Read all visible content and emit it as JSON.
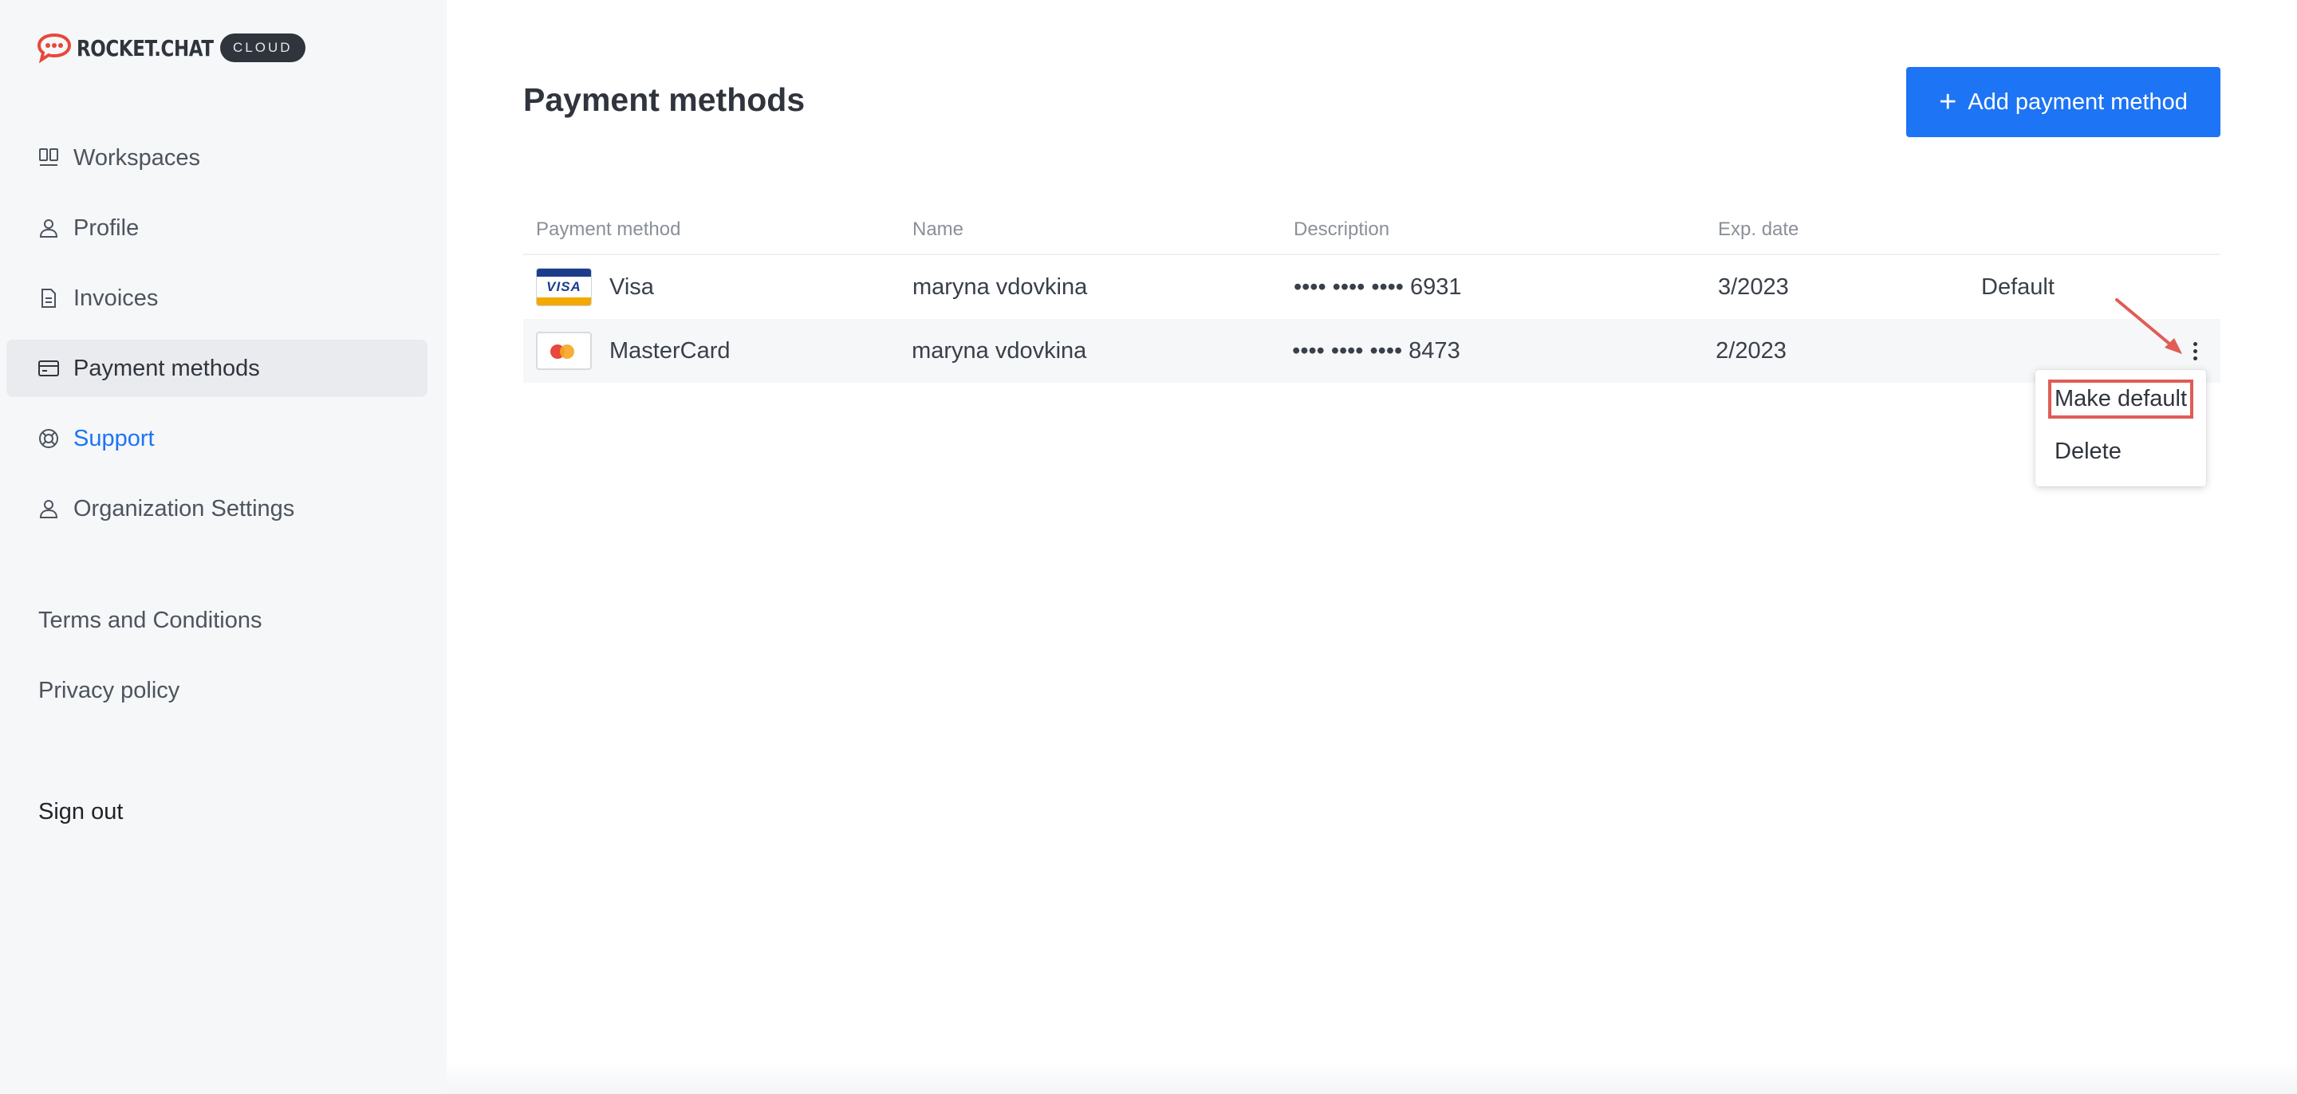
{
  "brand": {
    "wordmark": "ROCKET.CHAT",
    "badge": "CLOUD",
    "accent_color": "#e8473c"
  },
  "sidebar": {
    "items": [
      {
        "label": "Workspaces",
        "icon": "workspaces-icon"
      },
      {
        "label": "Profile",
        "icon": "user-icon"
      },
      {
        "label": "Invoices",
        "icon": "document-icon"
      },
      {
        "label": "Payment methods",
        "icon": "credit-card-icon",
        "active": true
      },
      {
        "label": "Support",
        "icon": "lifebuoy-icon",
        "color": "#1d74f5"
      },
      {
        "label": "Organization Settings",
        "icon": "user-icon"
      }
    ],
    "terms": "Terms and Conditions",
    "privacy": "Privacy policy",
    "signout": "Sign out"
  },
  "main": {
    "title": "Payment methods",
    "add_button": "Add payment method",
    "primary_color": "#1d74f5",
    "table": {
      "headers": [
        "Payment method",
        "Name",
        "Description",
        "Exp. date"
      ],
      "rows": [
        {
          "method": "Visa",
          "name": "maryna vdovkina",
          "description": "•••• •••• •••• 6931",
          "exp": "3/2023",
          "default": "Default"
        },
        {
          "method": "MasterCard",
          "name": "maryna vdovkina",
          "description": "•••• •••• •••• 8473",
          "exp": "2/2023",
          "default": ""
        }
      ]
    },
    "context_menu": {
      "make_default": "Make default",
      "delete": "Delete"
    }
  }
}
